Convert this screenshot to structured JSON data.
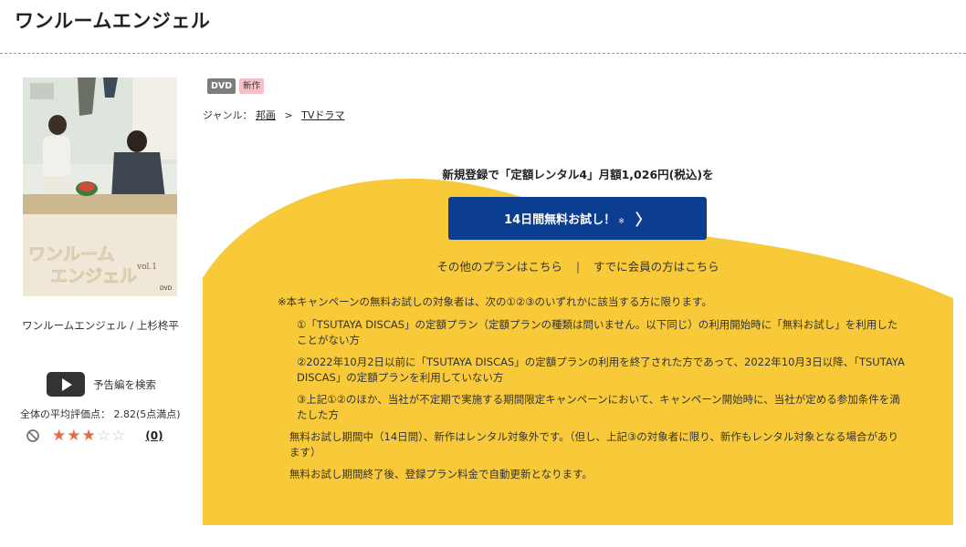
{
  "page": {
    "title": "ワンルームエンジェル"
  },
  "sidebar": {
    "cover": {
      "title_art_line1": "ワンルーム",
      "title_art_line2": "エンジェル",
      "vol": "vol.1",
      "brand": "DVD"
    },
    "caption": "ワンルームエンジェル / 上杉柊平",
    "trailer_label": "予告編を検索",
    "rating_text": "全体の平均評価点： 2.82(5点満点)",
    "rating_value": 3,
    "rating_max": 5,
    "review_count": "(0)",
    "colors": {
      "star_on": "#e66a47",
      "star_off": "#c8c8c8"
    }
  },
  "badges": {
    "format": "DVD",
    "new": "新作"
  },
  "genre": {
    "label": "ジャンル：",
    "level1": "邦画",
    "separator": ">",
    "level2": "TVドラマ"
  },
  "promo": {
    "headline": "新規登録で「定額レンタル4」月額1,026円(税込)を",
    "cta_label": "14日間無料お試し！",
    "cta_note": "※",
    "cta_arrow": "〉",
    "other_plans": "その他のプランはこちら",
    "divider": "|",
    "member_link": "すでに会員の方はこちら",
    "colors": {
      "background": "#f8ca3a",
      "button": "#0b3d91"
    }
  },
  "notes": {
    "intro": "※本キャンペーンの無料お試しの対象者は、次の①②③のいずれかに該当する方に限ります。",
    "item1": "①「TSUTAYA DISCAS」の定額プラン（定額プランの種類は問いません。以下同じ）の利用開始時に「無料お試し」を利用したことがない方",
    "item2": "②2022年10月2日以前に「TSUTAYA DISCAS」の定額プランの利用を終了された方であって、2022年10月3日以降、「TSUTAYA DISCAS」の定額プランを利用していない方",
    "item3": "③上記①②のほか、当社が不定期で実施する期間限定キャンペーンにおいて、キャンペーン開始時に、当社が定める参加条件を満たした方",
    "trial_note": "無料お試し期間中（14日間）、新作はレンタル対象外です。（但し、上記③の対象者に限り、新作もレンタル対象となる場合があります）",
    "renewal_note": "無料お試し期間終了後、登録プラン料金で自動更新となります。"
  }
}
